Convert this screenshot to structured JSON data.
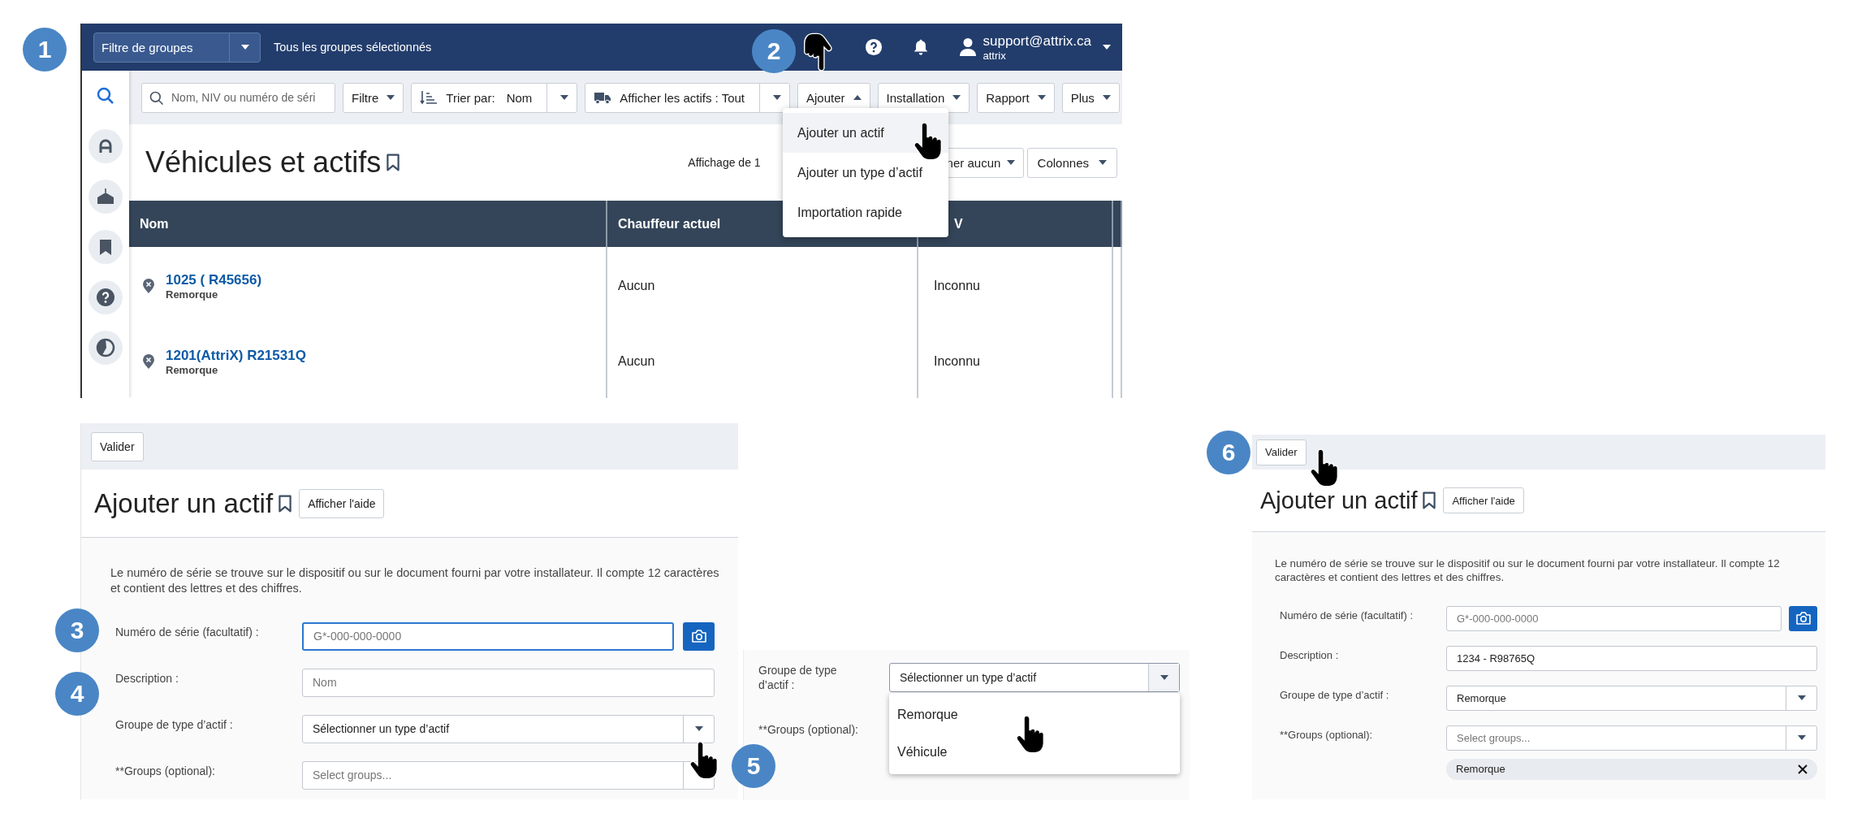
{
  "badges": [
    "1",
    "2",
    "3",
    "4",
    "5",
    "6"
  ],
  "vehicles_screen": {
    "group_filter": "Filtre de groupes",
    "group_status": "Tous les groupes sélectionnés",
    "user": {
      "email": "support@attrix.ca",
      "name": "attrix"
    },
    "sidebar": [
      {
        "selected": true
      },
      {
        "selected": false
      },
      {
        "selected": false
      },
      {
        "selected": false
      },
      {
        "selected": false
      },
      {
        "selected": false
      }
    ],
    "search_placeholder": "Nom, NIV ou numéro de séri",
    "toolbar": [
      {
        "kind": "dropdown",
        "label": "Filtre",
        "expanded": false
      },
      {
        "kind": "sort",
        "label": "Trier par:",
        "value": "Nom"
      },
      {
        "kind": "split",
        "label": "Afficher les actifs : Tout"
      },
      {
        "kind": "dropdown",
        "label": "Ajouter",
        "expanded": true
      },
      {
        "kind": "dropdown",
        "label": "Installation",
        "expanded": false
      },
      {
        "kind": "dropdown",
        "label": "Rapport",
        "expanded": false
      },
      {
        "kind": "dropdown",
        "label": "Plus",
        "expanded": false
      }
    ],
    "title": "Véhicules et actifs",
    "paging": "Affichage de 1",
    "select_none": "ner aucun",
    "columns_button": "Colonnes",
    "table": {
      "columns": [
        "Nom",
        "Chauffeur actuel",
        "V"
      ],
      "rows": [
        {
          "name": "1025 ( R45656)",
          "type": "Remorque",
          "driver": "Aucun",
          "vin": "Inconnu"
        },
        {
          "name": "1201(AttriX) R21531Q",
          "type": "Remorque",
          "driver": "Aucun",
          "vin": "Inconnu"
        }
      ]
    },
    "menu": [
      {
        "label": "Ajouter un actif",
        "selected": true
      },
      {
        "label": "Ajouter un type d’actif",
        "selected": false
      },
      {
        "label": "Importation rapide",
        "selected": false
      }
    ]
  },
  "add_form": {
    "submit": "Valider",
    "title": "Ajouter un actif",
    "help_button": "Afficher l'aide",
    "intro": "Le numéro de série se trouve sur le dispositif ou sur le document fourni par votre installateur. Il compte 12 caractères et contient des lettres et des chiffres.",
    "fields": [
      {
        "kind": "text",
        "label": "Numéro de série (facultatif) :",
        "placeholder": "G*-000-000-0000",
        "focused": true,
        "camera": true
      },
      {
        "kind": "text",
        "label": "Description :",
        "placeholder": "Nom",
        "focused": false
      },
      {
        "kind": "select",
        "label": "Groupe de type d’actif :",
        "value": "Sélectionner un type d’actif",
        "focused": false
      },
      {
        "kind": "select",
        "label": "**Groups (optional):",
        "placeholder": "Select groups...",
        "focused": false
      }
    ]
  },
  "type_dropdown": {
    "label": "Groupe de type d’actif :",
    "value": "Sélectionner un type d’actif",
    "options": [
      {
        "label": "Remorque",
        "selected": false
      },
      {
        "label": "Véhicule",
        "selected": false
      }
    ],
    "next_label": "**Groups (optional):"
  },
  "filled_form": {
    "submit": "Valider",
    "title": "Ajouter un actif",
    "help_button": "Afficher l'aide",
    "intro": "Le numéro de série se trouve sur le dispositif ou sur le document fourni par votre installateur. Il compte 12 caractères et contient des lettres et des chiffres.",
    "fields": [
      {
        "kind": "text",
        "label": "Numéro de série (facultatif) :",
        "placeholder": "G*-000-000-0000",
        "focused": false,
        "camera": true
      },
      {
        "kind": "text",
        "label": "Description :",
        "value": "1234 - R98765Q",
        "focused": false
      },
      {
        "kind": "select",
        "label": "Groupe de type d’actif :",
        "value": "Remorque",
        "focused": false
      },
      {
        "kind": "select",
        "label": "**Groups (optional):",
        "placeholder": "Select groups...",
        "focused": false,
        "chips": [
          "Remorque"
        ]
      }
    ]
  }
}
